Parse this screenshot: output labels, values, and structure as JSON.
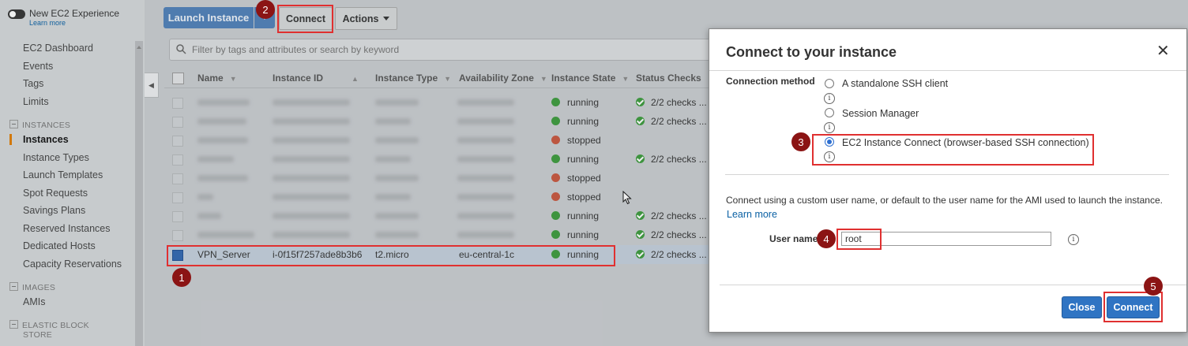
{
  "sidebar": {
    "experience_label": "New EC2 Experience",
    "learn_more": "Learn more",
    "items": [
      "EC2 Dashboard",
      "Events",
      "Tags",
      "Limits"
    ],
    "instances_section": "INSTANCES",
    "instances_items": [
      "Instances",
      "Instance Types",
      "Launch Templates",
      "Spot Requests",
      "Savings Plans",
      "Reserved Instances",
      "Dedicated Hosts",
      "Capacity Reservations"
    ],
    "images_section": "IMAGES",
    "images_items": [
      "AMIs"
    ],
    "ebs_section_line1": "ELASTIC BLOCK",
    "ebs_section_line2": "STORE"
  },
  "toolbar": {
    "launch_label": "Launch Instance",
    "connect_label": "Connect",
    "actions_label": "Actions"
  },
  "filter": {
    "placeholder": "Filter by tags and attributes or search by keyword"
  },
  "table": {
    "columns": [
      "Name",
      "Instance ID",
      "Instance Type",
      "Availability Zone",
      "Instance State",
      "Status Checks"
    ],
    "rows": [
      {
        "state": "running",
        "checks": "2/2 checks ..."
      },
      {
        "state": "running",
        "checks": "2/2 checks ..."
      },
      {
        "state": "stopped",
        "checks": ""
      },
      {
        "state": "running",
        "checks": "2/2 checks ..."
      },
      {
        "state": "stopped",
        "checks": ""
      },
      {
        "state": "stopped",
        "checks": ""
      },
      {
        "state": "running",
        "checks": "2/2 checks ..."
      },
      {
        "state": "running",
        "checks": "2/2 checks ..."
      },
      {
        "name": "VPN_Server",
        "id": "i-0f15f7257ade8b3b6",
        "type": "t2.micro",
        "zone": "eu-central-1c",
        "state": "running",
        "checks": "2/2 checks ..."
      }
    ]
  },
  "modal": {
    "title": "Connect to your instance",
    "connection_method_label": "Connection method",
    "options": [
      "A standalone SSH client",
      "Session Manager",
      "EC2 Instance Connect (browser-based SSH connection)"
    ],
    "selected_option": "EC2 Instance Connect (browser-based SSH connection)",
    "description": "Connect using a custom user name, or default to the user name for the AMI used to launch the instance.",
    "learn_more": "Learn more",
    "user_name_label": "User name",
    "user_name_value": "root",
    "close_label": "Close",
    "connect_label": "Connect",
    "info_glyph": "i",
    "close_glyph": "✕"
  },
  "annotations": {
    "steps": [
      "1",
      "2",
      "3",
      "4",
      "5"
    ],
    "color": "#e03030",
    "badge_color": "#8b1414"
  },
  "colors": {
    "running": "#3c9a3c",
    "stopped": "#c8553d",
    "accent": "#2f74c3"
  }
}
